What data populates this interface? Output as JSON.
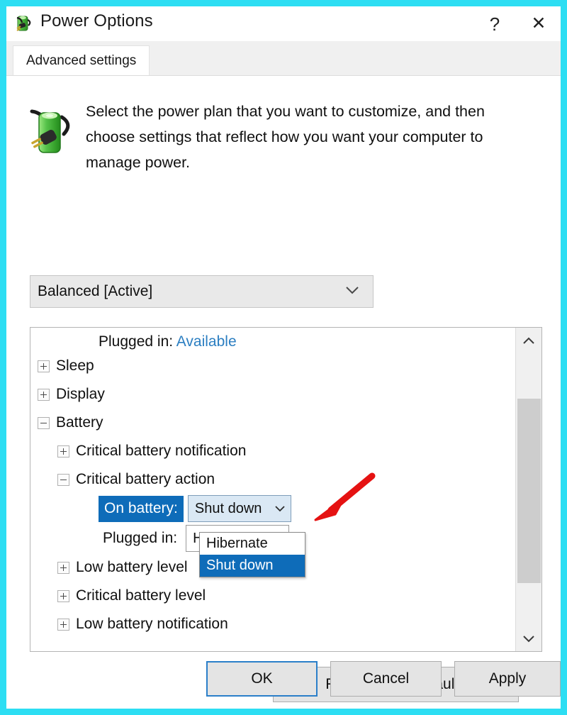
{
  "window": {
    "title": "Power Options",
    "icon": "power-plug-battery-icon",
    "help_label": "?",
    "close_label": "✕",
    "frame_color": "#2ddef3"
  },
  "tabs": [
    {
      "label": "Advanced settings",
      "active": true
    }
  ],
  "intro": {
    "icon": "battery-plug-icon",
    "text": "Select the power plan that you want to customize, and then choose settings that reflect how you want your computer to manage power."
  },
  "plan_select": {
    "value": "Balanced [Active]",
    "chevron": "chevron-down-icon",
    "options": [
      "Balanced [Active]"
    ]
  },
  "settings": {
    "plugged_header": {
      "label": "Plugged in:",
      "status": "Available",
      "status_color": "#2b7ec1"
    },
    "tree": [
      {
        "label": "Sleep",
        "level": 0,
        "state": "collapsed"
      },
      {
        "label": "Display",
        "level": 0,
        "state": "collapsed"
      },
      {
        "label": "Battery",
        "level": 0,
        "state": "expanded"
      },
      {
        "label": "Critical battery notification",
        "level": 1,
        "state": "collapsed"
      },
      {
        "label": "Critical battery action",
        "level": 1,
        "state": "expanded"
      }
    ],
    "values": [
      {
        "label": "On battery:",
        "value": "Shut down",
        "selected": true
      },
      {
        "label": "Plugged in:",
        "value": "Hibernate",
        "selected": false
      }
    ],
    "tree_after": [
      {
        "label": "Low battery level",
        "level": 1,
        "state": "collapsed"
      },
      {
        "label": "Critical battery level",
        "level": 1,
        "state": "collapsed"
      },
      {
        "label": "Low battery notification",
        "level": 1,
        "state": "collapsed"
      }
    ],
    "dropdown": {
      "open": true,
      "items": [
        {
          "label": "Hibernate",
          "selected": false
        },
        {
          "label": "Shut down",
          "selected": true
        }
      ]
    },
    "scrollbar": {
      "up_arrow": "chevron-up-icon",
      "down_arrow": "chevron-down-icon"
    }
  },
  "buttons": {
    "restore": "Restore plan defaults",
    "ok": "OK",
    "cancel": "Cancel",
    "apply": "Apply"
  },
  "annotation": {
    "arrow": "red-arrow-annotation",
    "color": "#e51212"
  }
}
